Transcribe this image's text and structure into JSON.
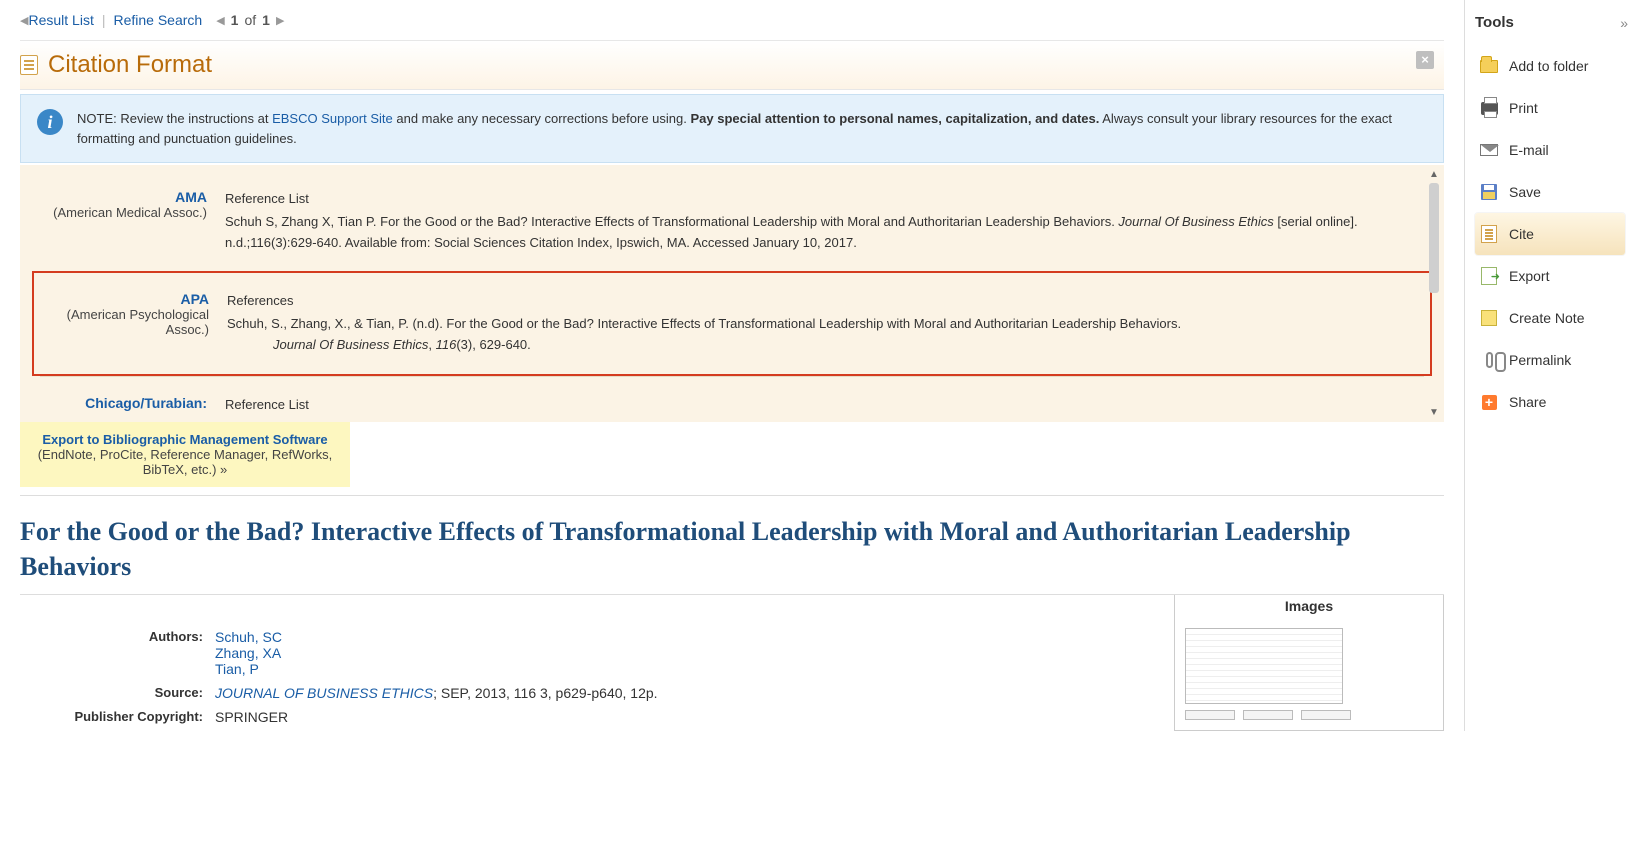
{
  "nav": {
    "resultList": "Result List",
    "refine": "Refine Search",
    "pager_current": "1",
    "pager_of": "of",
    "pager_total": "1"
  },
  "citation": {
    "title": "Citation Format",
    "note_prefix": "NOTE: Review the instructions at ",
    "note_link": "EBSCO Support Site",
    "note_mid": " and make any necessary corrections before using. ",
    "note_bold": "Pay special attention to personal names, capitalization, and dates.",
    "note_suffix": " Always consult your library resources for the exact formatting and punctuation guidelines.",
    "formats": {
      "ama": {
        "label": "AMA",
        "sub": "(American Medical Assoc.)",
        "head": "Reference List",
        "body_plain1": "Schuh S, Zhang X, Tian P. For the Good or the Bad? Interactive Effects of Transformational Leadership with Moral and Authoritarian Leadership Behaviors. ",
        "body_ital": "Journal Of Business Ethics",
        "body_plain2": " [serial online]. n.d.;116(3):629-640. Available from: Social Sciences Citation Index, Ipswich, MA. Accessed January 10, 2017."
      },
      "apa": {
        "label": "APA",
        "sub": "(American Psychological Assoc.)",
        "head": "References",
        "body_plain1": "Schuh, S., Zhang, X., & Tian, P. (n.d). For the Good or the Bad? Interactive Effects of Transformational Leadership with Moral and Authoritarian Leadership Behaviors.",
        "body_ital1": "Journal Of Business Ethics",
        "body_comma": ", ",
        "body_ital2": "116",
        "body_plain2": "(3), 629-640."
      },
      "chicago": {
        "label": "Chicago/Turabian:",
        "head": "Reference List"
      }
    },
    "export": {
      "link": "Export to Bibliographic Management Software",
      "sub": "(EndNote, ProCite, Reference Manager, RefWorks, BibTeX, etc.) »"
    }
  },
  "article": {
    "title_bold": "For the Good or the Bad? Interactive Effects",
    "title_rest": " of Transformational Leadership with Moral and Authoritarian Leadership Behaviors",
    "labels": {
      "authors": "Authors:",
      "source": "Source:",
      "pub": "Publisher Copyright:"
    },
    "authors": [
      "Schuh, SC",
      "Zhang, XA",
      "Tian, P"
    ],
    "source_link": "JOURNAL OF BUSINESS ETHICS",
    "source_rest": "; SEP, 2013, 116 3, p629-p640, 12p.",
    "publisher": "SPRINGER",
    "images_title": "Images"
  },
  "tools": {
    "heading": "Tools",
    "items": {
      "folder": "Add to folder",
      "print": "Print",
      "email": "E-mail",
      "save": "Save",
      "cite": "Cite",
      "export": "Export",
      "note": "Create Note",
      "permalink": "Permalink",
      "share": "Share"
    }
  }
}
